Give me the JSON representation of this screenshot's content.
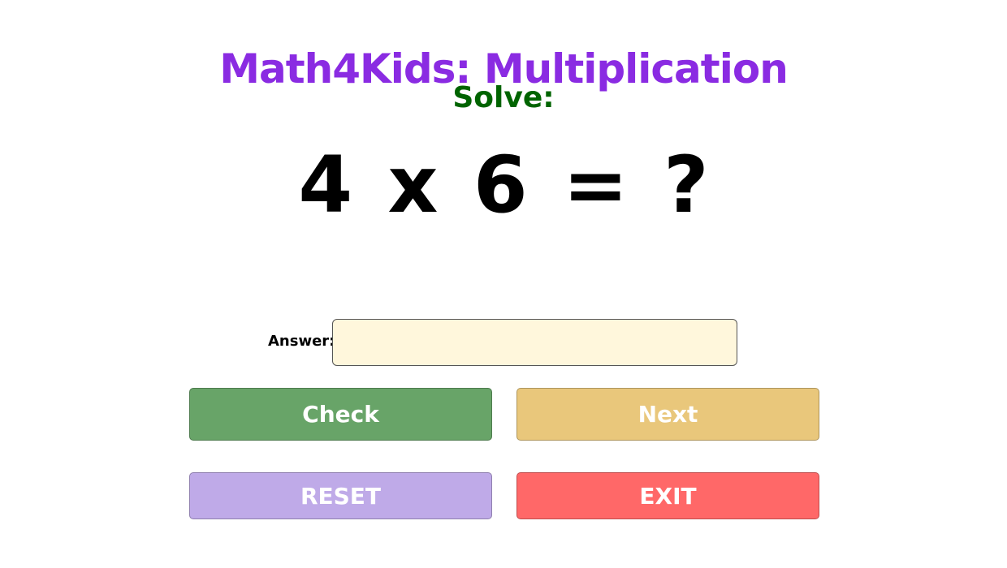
{
  "app": {
    "title": "Math4Kids: Multiplication"
  },
  "prompt": {
    "label": "Solve:",
    "problem": "4 x 6 = ?"
  },
  "answer": {
    "label": "Answer:",
    "value": "",
    "placeholder": ""
  },
  "buttons": {
    "check": "Check",
    "next": "Next",
    "reset": "RESET",
    "exit": "EXIT"
  },
  "colors": {
    "title": "#8a2be2",
    "solve": "#006400",
    "input_background": "#fff7dc",
    "check": "#68a468",
    "next": "#e9c77b",
    "reset": "#bfaae8",
    "exit": "#ff6868"
  }
}
